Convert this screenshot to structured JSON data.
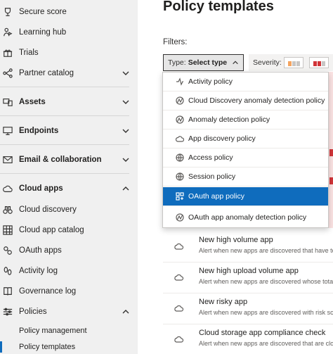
{
  "sidebar": {
    "items": [
      {
        "label": "Secure score",
        "icon": "trophy-icon"
      },
      {
        "label": "Learning hub",
        "icon": "person-learning-icon"
      },
      {
        "label": "Trials",
        "icon": "gift-icon"
      },
      {
        "label": "Partner catalog",
        "icon": "nodes-icon"
      },
      {
        "label": "Assets",
        "icon": "devices-icon"
      },
      {
        "label": "Endpoints",
        "icon": "monitor-icon"
      },
      {
        "label": "Email & collaboration",
        "icon": "mail-icon"
      },
      {
        "label": "Cloud apps",
        "icon": "cloud-icon"
      },
      {
        "label": "Cloud discovery",
        "icon": "binoculars-icon"
      },
      {
        "label": "Cloud app catalog",
        "icon": "grid-icon"
      },
      {
        "label": "OAuth apps",
        "icon": "connected-apps-icon"
      },
      {
        "label": "Activity log",
        "icon": "footprint-icon"
      },
      {
        "label": "Governance log",
        "icon": "book-icon"
      },
      {
        "label": "Policies",
        "icon": "sliders-icon"
      },
      {
        "label": "Policy management",
        "icon": ""
      },
      {
        "label": "Policy templates",
        "icon": ""
      }
    ]
  },
  "main": {
    "title": "Policy templates",
    "filters_label": "Filters:",
    "type_filter": {
      "prefix": "Type:",
      "value": "Select type"
    },
    "severity_label": "Severity:",
    "dropdown": {
      "options": [
        {
          "label": "Activity policy",
          "icon": "activity-icon",
          "selected": false
        },
        {
          "label": "Cloud Discovery anomaly detection policy",
          "icon": "anomaly-icon",
          "selected": false
        },
        {
          "label": "Anomaly detection policy",
          "icon": "anomaly-icon",
          "selected": false
        },
        {
          "label": "App discovery policy",
          "icon": "cloud-icon",
          "selected": false
        },
        {
          "label": "Access policy",
          "icon": "globe-icon",
          "selected": false
        },
        {
          "label": "Session policy",
          "icon": "globe-icon",
          "selected": false
        },
        {
          "label": "OAuth app policy",
          "icon": "oauth-icon",
          "selected": true
        },
        {
          "label": "OAuth app anomaly detection policy",
          "icon": "anomaly-icon",
          "selected": false
        }
      ]
    },
    "templates": [
      {
        "name": "New high volume app",
        "desc": "Alert when new apps are discovered that have total"
      },
      {
        "name": "New high upload volume app",
        "desc": "Alert when new apps are discovered whose total daily"
      },
      {
        "name": "New risky app",
        "desc": "Alert when new apps are discovered with risk score lower"
      },
      {
        "name": "Cloud storage app compliance check",
        "desc": "Alert when new apps are discovered that are cloud storage"
      }
    ]
  },
  "colors": {
    "accent": "#0f6cbd",
    "sidebar_bg": "#f0f0f0",
    "severity_high": "#d13438",
    "severity_medium": "#f4a460"
  }
}
